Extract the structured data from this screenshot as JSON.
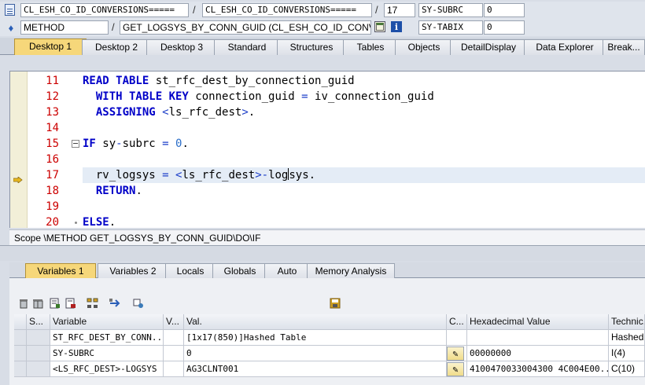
{
  "header": {
    "row1": {
      "class_field": "CL_ESH_CO_ID_CONVERSIONS=====",
      "include_field": "CL_ESH_CO_ID_CONVERSIONS=====",
      "line": "17",
      "sysvar_name": "SY-SUBRC",
      "sysvar_value": "0"
    },
    "row2": {
      "type": "METHOD",
      "event": "GET_LOGSYS_BY_CONN_GUID (CL_ESH_CO_ID_CONV...",
      "sysvar_name": "SY-TABIX",
      "sysvar_value": "0"
    },
    "separator": "/"
  },
  "desktop_tabs": [
    {
      "label": "Desktop 1",
      "active": true
    },
    {
      "label": "Desktop 2",
      "active": false
    },
    {
      "label": "Desktop 3",
      "active": false
    },
    {
      "label": "Standard",
      "active": false
    },
    {
      "label": "Structures",
      "active": false
    },
    {
      "label": "Tables",
      "active": false
    },
    {
      "label": "Objects",
      "active": false
    },
    {
      "label": "DetailDisplay",
      "active": false
    },
    {
      "label": "Data Explorer",
      "active": false
    },
    {
      "label": "Break...",
      "active": false
    }
  ],
  "code": {
    "current_line": "17",
    "lines": [
      {
        "num": "11",
        "parts": [
          [
            "kw",
            "READ TABLE"
          ],
          [
            "t",
            " st_rfc_dest_by_connection_guid"
          ]
        ]
      },
      {
        "num": "12",
        "parts": [
          [
            "t",
            "  "
          ],
          [
            "kw",
            "WITH TABLE KEY"
          ],
          [
            "t",
            " connection_guid "
          ],
          [
            "op",
            "="
          ],
          [
            "t",
            " iv_connection_guid"
          ]
        ]
      },
      {
        "num": "13",
        "parts": [
          [
            "t",
            "  "
          ],
          [
            "kw",
            "ASSIGNING"
          ],
          [
            "t",
            " "
          ],
          [
            "op",
            "<"
          ],
          [
            "t",
            "ls_rfc_dest"
          ],
          [
            "op",
            ">"
          ],
          [
            "t",
            "."
          ]
        ]
      },
      {
        "num": "14",
        "parts": []
      },
      {
        "num": "15",
        "parts": [
          [
            "kw",
            "IF"
          ],
          [
            "t",
            " sy"
          ],
          [
            "op",
            "-"
          ],
          [
            "t",
            "subrc "
          ],
          [
            "op",
            "="
          ],
          [
            "t",
            " "
          ],
          [
            "lit",
            "0"
          ],
          [
            "t",
            "."
          ]
        ]
      },
      {
        "num": "16",
        "parts": []
      },
      {
        "num": "17",
        "parts": [
          [
            "t",
            "  rv_logsys "
          ],
          [
            "op",
            "="
          ],
          [
            "t",
            " "
          ],
          [
            "op",
            "<"
          ],
          [
            "t",
            "ls_rfc_dest"
          ],
          [
            "op",
            ">"
          ],
          [
            "op",
            "-"
          ],
          [
            "t",
            "log"
          ],
          [
            "caret",
            ""
          ],
          [
            "t",
            "sys."
          ]
        ]
      },
      {
        "num": "18",
        "parts": [
          [
            "t",
            "  "
          ],
          [
            "kw",
            "RETURN"
          ],
          [
            "t",
            "."
          ]
        ]
      },
      {
        "num": "19",
        "parts": []
      },
      {
        "num": "20",
        "parts": [
          [
            "kw",
            "ELSE"
          ],
          [
            "t",
            "."
          ]
        ]
      }
    ]
  },
  "scope": "Scope \\METHOD GET_LOGSYS_BY_CONN_GUID\\DO\\IF",
  "variable_tabs": [
    {
      "label": "Variables 1",
      "active": true
    },
    {
      "label": "Variables 2",
      "active": false
    },
    {
      "label": "Locals",
      "active": false
    },
    {
      "label": "Globals",
      "active": false
    },
    {
      "label": "Auto",
      "active": false
    },
    {
      "label": "Memory Analysis",
      "active": false
    }
  ],
  "toolbar_icons": [
    "delete-icon",
    "delete-all-icon",
    "save-variables-icon",
    "load-variables-icon",
    "hierarchy-icon",
    "navigate-icon",
    "settings-icon",
    "save-icon"
  ],
  "table": {
    "columns": [
      "S...",
      "Variable",
      "V...",
      "Val.",
      "C...",
      "Hexadecimal Value",
      "Technic..."
    ],
    "rows": [
      {
        "variable": "ST_RFC_DEST_BY_CONN...",
        "v": "",
        "value": "[1x17(850)]Hashed Table",
        "change": false,
        "hex": "",
        "tech": "Hashed T"
      },
      {
        "variable": "SY-SUBRC",
        "v": "",
        "value": "0",
        "change": true,
        "hex": "00000000",
        "tech": "I(4)"
      },
      {
        "variable": "<LS_RFC_DEST>-LOGSYS",
        "v": "",
        "value": "AG3CLNT001",
        "change": true,
        "hex": "4100470033004300 4C004E00...",
        "tech": "C(10)"
      }
    ]
  }
}
